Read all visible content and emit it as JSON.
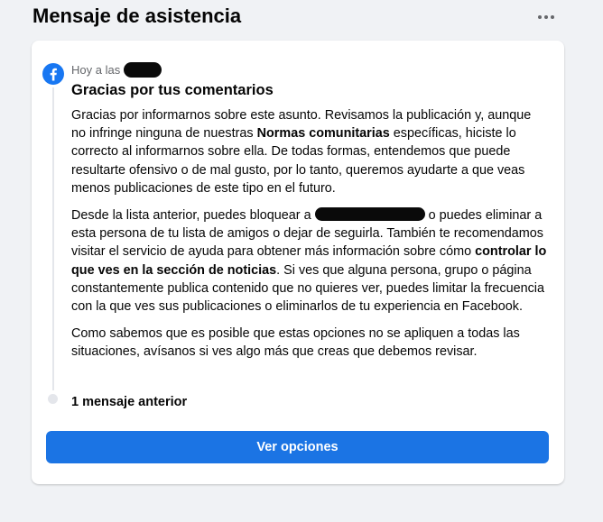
{
  "header": {
    "title": "Mensaje de asistencia",
    "more_icon": "more-horizontal-icon"
  },
  "message": {
    "badge_icon": "facebook-logo-icon",
    "brand_color": "#1877f2",
    "timestamp_prefix": "Hoy a las",
    "title": "Gracias por tus comentarios",
    "p1_a": "Gracias por informarnos sobre este asunto. Revisamos la publicación y, aunque no infringe ninguna de nuestras ",
    "p1_link": "Normas comunitarias",
    "p1_b": " específicas, hiciste lo correcto al informarnos sobre ella. De todas formas, entendemos que puede resultarte ofensivo o de mal gusto, por lo tanto, queremos ayudarte a que veas menos publicaciones de este tipo en el futuro.",
    "p2_a": "Desde la lista anterior, puedes bloquear a ",
    "p2_b": " o puedes eliminar a esta persona de tu lista de amigos o dejar de seguirla. También te recomendamos visitar el servicio de ayuda para obtener más información sobre cómo ",
    "p2_link": "controlar lo que ves en la sección de noticias",
    "p2_c": ". Si ves que alguna persona, grupo o página constantemente publica contenido que no quieres ver, puedes limitar la frecuencia con la que ves sus publicaciones o eliminarlos de tu experiencia en Facebook.",
    "p3": "Como sabemos que es posible que estas opciones no se apliquen a todas las situaciones, avísanos si ves algo más que creas que debemos revisar."
  },
  "previous": {
    "label": "1 mensaje anterior"
  },
  "actions": {
    "primary_label": "Ver opciones",
    "primary_color": "#1b74e4"
  }
}
